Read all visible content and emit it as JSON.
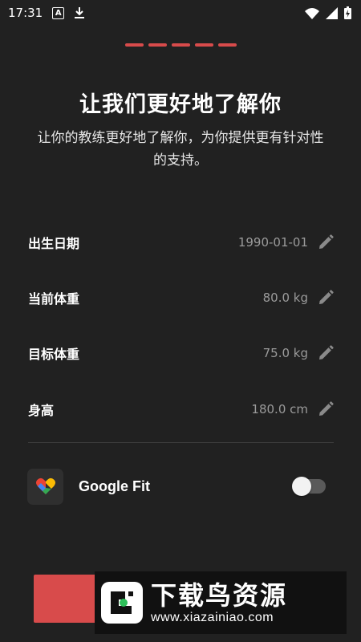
{
  "status_bar": {
    "time": "17:31",
    "icons": [
      "keyboard-a-icon",
      "download-icon",
      "wifi-icon",
      "cellular-icon",
      "battery-icon"
    ]
  },
  "progress": {
    "steps_total": 5,
    "accent_color": "#d84b4b"
  },
  "header": {
    "title": "让我们更好地了解你",
    "subtitle": "让你的教练更好地了解你，为你提供更有针对性的支持。"
  },
  "fields": [
    {
      "label": "出生日期",
      "value": "1990-01-01"
    },
    {
      "label": "当前体重",
      "value": "80.0 kg"
    },
    {
      "label": "目标体重",
      "value": "75.0 kg"
    },
    {
      "label": "身高",
      "value": "180.0 cm"
    }
  ],
  "google_fit": {
    "label": "Google Fit",
    "enabled": false,
    "icon": "google-fit-heart-icon"
  },
  "watermark": {
    "title": "下载鸟资源",
    "url": "www.xiazainiao.com"
  },
  "colors": {
    "background": "#212121",
    "accent": "#d84b4b",
    "value_text": "#9b9b9b"
  }
}
